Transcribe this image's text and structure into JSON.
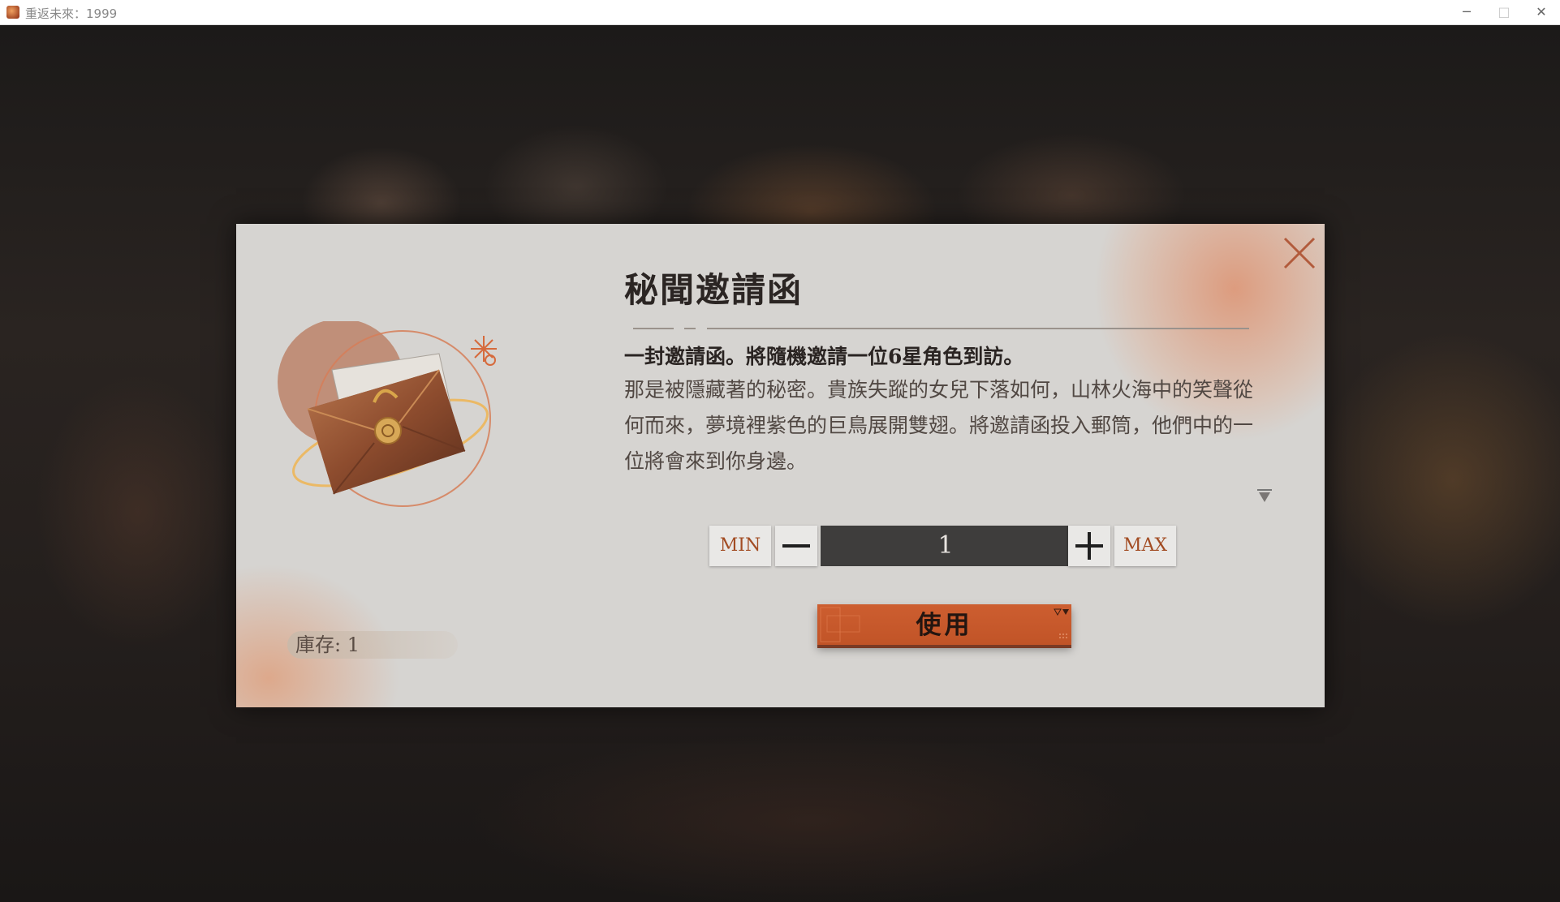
{
  "window": {
    "title": "重返未來：1999",
    "minimize": "─",
    "maximize": "□",
    "close": "✕"
  },
  "dialog": {
    "item_name": "秘聞邀請函",
    "description_main": "一封邀請函。將隨機邀請一位6星角色到訪。",
    "description_body": "那是被隱藏著的秘密。貴族失蹤的女兒下落如何，山林火海中的笑聲從何而來，夢境裡紫色的巨鳥展開雙翅。將邀請函投入郵筒，他們中的一位將會來到你身邊。",
    "stock_label": "庫存:",
    "stock_value": "1",
    "quantity": {
      "min_label": "MIN",
      "max_label": "MAX",
      "value": "1"
    },
    "use_button": "使用",
    "accent_color": "#c45a2c"
  },
  "icons": {
    "close": "close-x-icon",
    "minus": "minus-icon",
    "plus": "plus-icon",
    "more": "triangle-down-icon",
    "item": "invitation-envelope-icon"
  }
}
